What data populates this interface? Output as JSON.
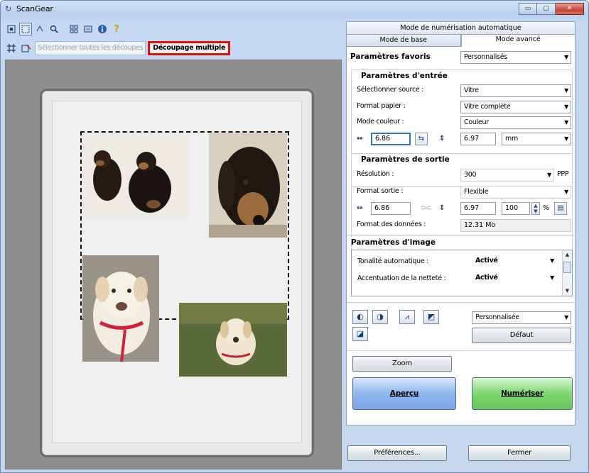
{
  "window": {
    "title": "ScanGear",
    "minimize": "▭",
    "maximize": "▢",
    "close": "✕"
  },
  "toolbar": {
    "tools": [
      "frame-icon",
      "crop-icon",
      "rotate-icon",
      "zoom-icon",
      "thumbnail-icon",
      "whole-icon",
      "info-icon",
      "help-icon"
    ],
    "select_all_crops": "Sélectionner toutes les découpes",
    "multi_crop": "Découpage multiple"
  },
  "tabs": {
    "auto_scan": "Mode de numérisation automatique",
    "basic": "Mode de base",
    "advanced": "Mode avancé"
  },
  "favorites": {
    "label": "Paramètres favoris",
    "value": "Personnalisés"
  },
  "input": {
    "header": "Paramètres d'entrée",
    "source_label": "Sélectionner source :",
    "source_value": "Vitre",
    "paper_label": "Format papier :",
    "paper_value": "Vitre complète",
    "color_label": "Mode couleur :",
    "color_value": "Couleur",
    "width": "6.86",
    "height": "6.97",
    "unit": "mm"
  },
  "output": {
    "header": "Paramètres de sortie",
    "resolution_label": "Résolution :",
    "resolution_value": "300",
    "resolution_unit": "PPP",
    "size_label": "Format sortie :",
    "size_value": "Flexible",
    "width": "6.86",
    "height": "6.97",
    "scale": "100",
    "scale_unit": "%",
    "data_size_label": "Format des données :",
    "data_size_value": "12.31 Mo"
  },
  "image": {
    "header": "Paramètres d'image",
    "items": [
      {
        "label": "Tonalité automatique :",
        "value": "Activé"
      },
      {
        "label": "Accentuation de la netteté :",
        "value": "Activé"
      }
    ],
    "tone_preset": "Personnalisée",
    "default_btn": "Défaut"
  },
  "buttons": {
    "zoom": "Zoom",
    "preview": "Aperçu",
    "scan": "Numériser",
    "preferences": "Préférences...",
    "close": "Fermer"
  }
}
